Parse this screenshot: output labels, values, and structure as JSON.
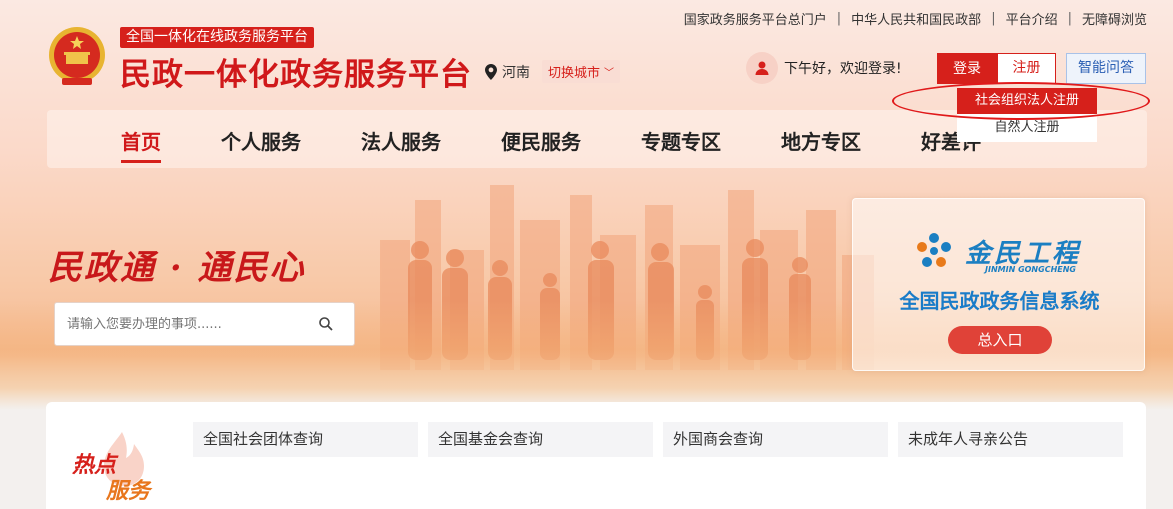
{
  "top_links": [
    "国家政务服务平台总门户",
    "中华人民共和国民政部",
    "平台介绍",
    "无障碍浏览"
  ],
  "header": {
    "subtitle": "全国一体化在线政务服务平台",
    "title": "民政一体化政务服务平台",
    "location": "河南",
    "city_switch": "切换城市",
    "greeting": "下午好，欢迎登录!",
    "login": "登录",
    "register": "注册",
    "ai_qa": "智能问答"
  },
  "register_menu": [
    "社会组织法人注册",
    "自然人注册"
  ],
  "nav": [
    "首页",
    "个人服务",
    "法人服务",
    "便民服务",
    "专题专区",
    "地方专区",
    "好差评"
  ],
  "hero": {
    "slogan": "民政通 · 通民心",
    "search_placeholder": "请输入您要办理的事项......"
  },
  "card": {
    "logo_cn": "金民工程",
    "logo_en": "JINMIN GONGCHENG",
    "title": "全国民政政务信息系统",
    "button": "总入口"
  },
  "hot": {
    "label_top": "热点",
    "label_bottom": "服务",
    "items": [
      "全国社会团体查询",
      "全国基金会查询",
      "外国商会查询",
      "未成年人寻亲公告"
    ]
  },
  "colors": {
    "brand_red": "#d6201b",
    "jinmin_blue": "#1b7fc2"
  }
}
